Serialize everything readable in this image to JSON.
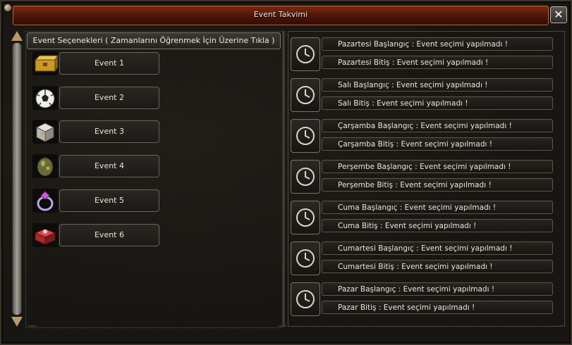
{
  "window": {
    "title": "Event Takvimi",
    "close_label": "✕"
  },
  "left": {
    "header": "Event Seçenekleri ( Zamanlarını Öğrenmek İçin Üzerine Tıkla )",
    "events": [
      {
        "label": "Event 1",
        "icon": "gold-chest-icon"
      },
      {
        "label": "Event 2",
        "icon": "soccer-ball-icon"
      },
      {
        "label": "Event 3",
        "icon": "mystery-box-icon"
      },
      {
        "label": "Event 4",
        "icon": "dragon-egg-icon"
      },
      {
        "label": "Event 5",
        "icon": "ring-icon"
      },
      {
        "label": "Event 6",
        "icon": "red-box-icon"
      }
    ]
  },
  "schedule": [
    {
      "start": "Pazartesi Başlangıç : Event seçimi yapılmadı !",
      "end": "Pazartesi Bitiş : Event seçimi yapılmadı !"
    },
    {
      "start": "Salı Başlangıç : Event seçimi yapılmadı !",
      "end": "Salı Bitiş : Event seçimi yapılmadı !"
    },
    {
      "start": "Çarşamba Başlangıç : Event seçimi yapılmadı !",
      "end": "Çarşamba Bitiş : Event seçimi yapılmadı !"
    },
    {
      "start": "Perşembe Başlangıç : Event seçimi yapılmadı !",
      "end": "Perşembe Bitiş : Event seçimi yapılmadı !"
    },
    {
      "start": "Cuma Başlangıç : Event seçimi yapılmadı !",
      "end": "Cuma Bitiş : Event seçimi yapılmadı !"
    },
    {
      "start": "Cumartesi Başlangıç : Event seçimi yapılmadı !",
      "end": "Cumartesi Bitiş : Event seçimi yapılmadı !"
    },
    {
      "start": "Pazar Başlangıç : Event seçimi yapılmadı !",
      "end": "Pazar Bitiş : Event seçimi yapılmadı !"
    }
  ],
  "colors": {
    "titlebar": "#4a1408",
    "accent_border": "#c46a3a",
    "panel_border": "#6b6356"
  }
}
